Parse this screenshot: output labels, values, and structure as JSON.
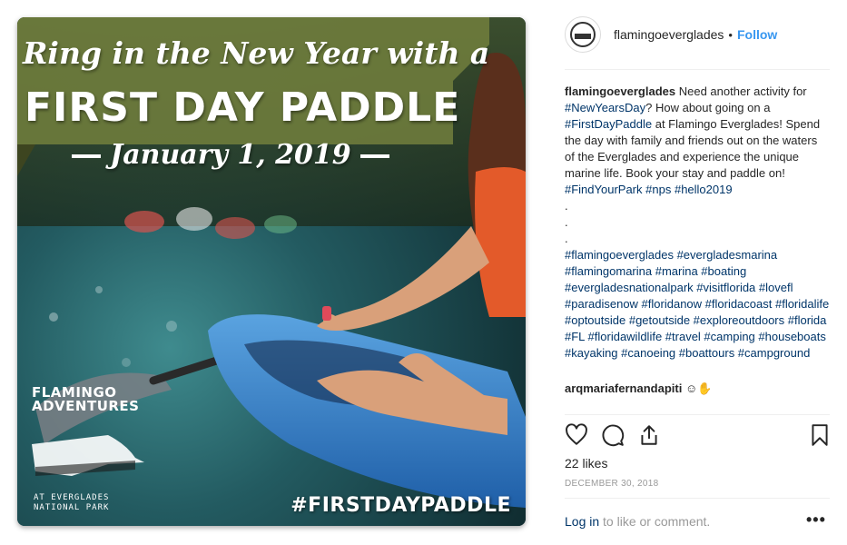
{
  "post_image": {
    "script_heading": "Ring in the New Year with a",
    "main_heading": "FIRST DAY PADDLE",
    "event_date": "January 1, 2019",
    "logo_name": "FLAMINGO ADVENTURES",
    "logo_sub": "AT EVERGLADES NATIONAL PARK",
    "hashtag": "#FIRSTDAYPADDLE"
  },
  "header": {
    "username": "flamingoeverglades",
    "separator": "•",
    "follow_label": "Follow"
  },
  "caption": {
    "username": "flamingoeverglades",
    "text_1": " Need another activity for ",
    "tag_1": "#NewYearsDay",
    "text_2": "? How about going on a ",
    "tag_2": "#FirstDayPaddle",
    "text_3": " at Flamingo Everglades! Spend the day with family and friends out on the waters of the Everglades and experience the unique marine life. Book your stay and paddle on! ",
    "tag_3": "#FindYourPark",
    "tag_4": "#nps",
    "tag_5": "#hello2019",
    "dot": ".",
    "hashtags": "#flamingoeverglades #evergladesmarina #flamingomarina #marina #boating #evergladesnationalpark #visitflorida #lovefl #paradisenow #floridanow #floridacoast #floridalife #optoutside #getoutside #exploreoutdoors #florida #FL #floridawildlife #travel #camping #houseboats #kayaking #canoeing #boattours #campground"
  },
  "comment": {
    "username": "arqmariafernandapiti",
    "text": " ☺✋"
  },
  "actions": {
    "like_icon": "heart-icon",
    "comment_icon": "comment-icon",
    "share_icon": "share-icon",
    "save_icon": "bookmark-icon"
  },
  "likes": "22 likes",
  "date": "DECEMBER 30, 2018",
  "login": {
    "link_label": "Log in",
    "rest": " to like or comment."
  },
  "more_label": "•••",
  "colors": {
    "link": "#003569",
    "follow": "#3897f0",
    "banner_green": "#6f7d3c"
  }
}
